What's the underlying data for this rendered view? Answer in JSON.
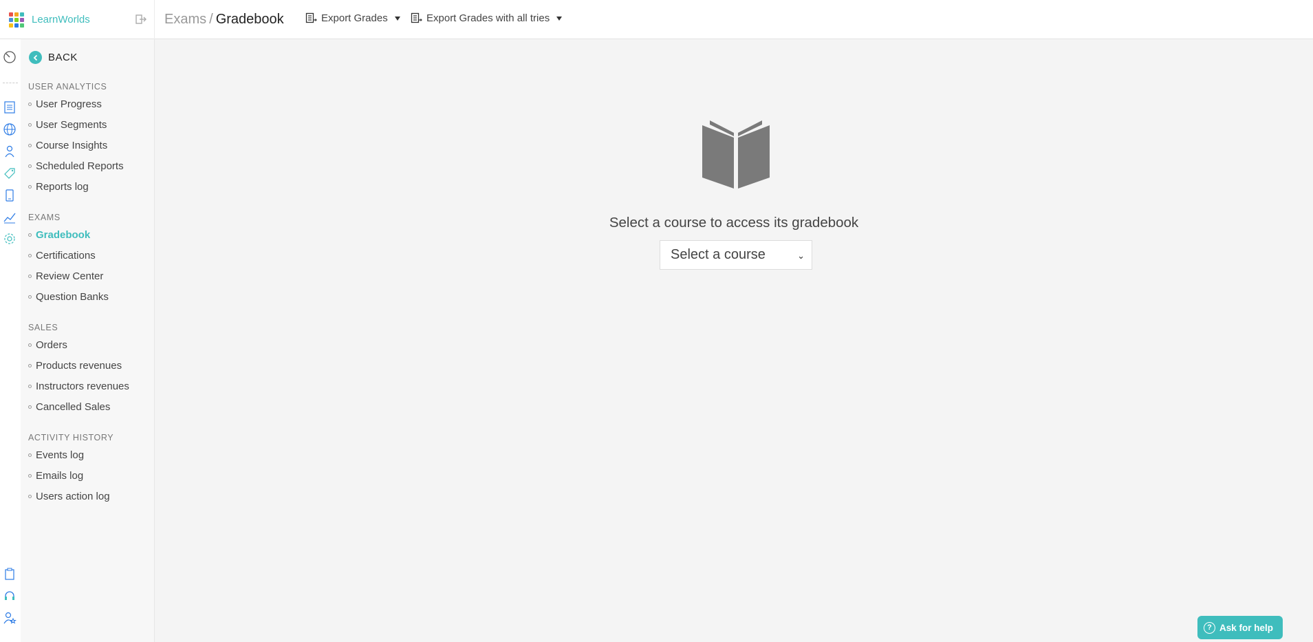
{
  "app": {
    "brand_name": "LearnWorlds",
    "brand_colors": [
      "#e8534b",
      "#f5a623",
      "#3fbdbd",
      "#4a90d9",
      "#7ed321",
      "#9b59b6",
      "#f8c01c",
      "#2c7be5",
      "#50c878"
    ],
    "accent_color": "#3fbdbd"
  },
  "header": {
    "breadcrumb_parent": "Exams",
    "breadcrumb_separator": "/",
    "breadcrumb_current": "Gradebook",
    "export_grades_label": "Export Grades",
    "export_all_tries_label": "Export Grades with all tries"
  },
  "sidebar": {
    "back_label": "BACK",
    "sections": [
      {
        "title": "USER ANALYTICS",
        "items": [
          "User Progress",
          "User Segments",
          "Course Insights",
          "Scheduled Reports",
          "Reports log"
        ]
      },
      {
        "title": "EXAMS",
        "items": [
          "Gradebook",
          "Certifications",
          "Review Center",
          "Question Banks"
        ]
      },
      {
        "title": "SALES",
        "items": [
          "Orders",
          "Products revenues",
          "Instructors revenues",
          "Cancelled Sales"
        ]
      },
      {
        "title": "ACTIVITY HISTORY",
        "items": [
          "Events log",
          "Emails log",
          "Users action log"
        ]
      }
    ],
    "active_item": "Gradebook"
  },
  "rail_icons": [
    "dashboard-icon",
    "pages-icon",
    "globe-icon",
    "users-icon",
    "tag-icon",
    "mobile-icon",
    "analytics-icon",
    "settings-icon",
    "clipboard-icon",
    "headset-icon",
    "user-star-icon"
  ],
  "main": {
    "empty_icon": "open-book-icon",
    "empty_message": "Select a course to access its gradebook",
    "course_select_value": "Select a course",
    "help_label": "Ask for help"
  }
}
